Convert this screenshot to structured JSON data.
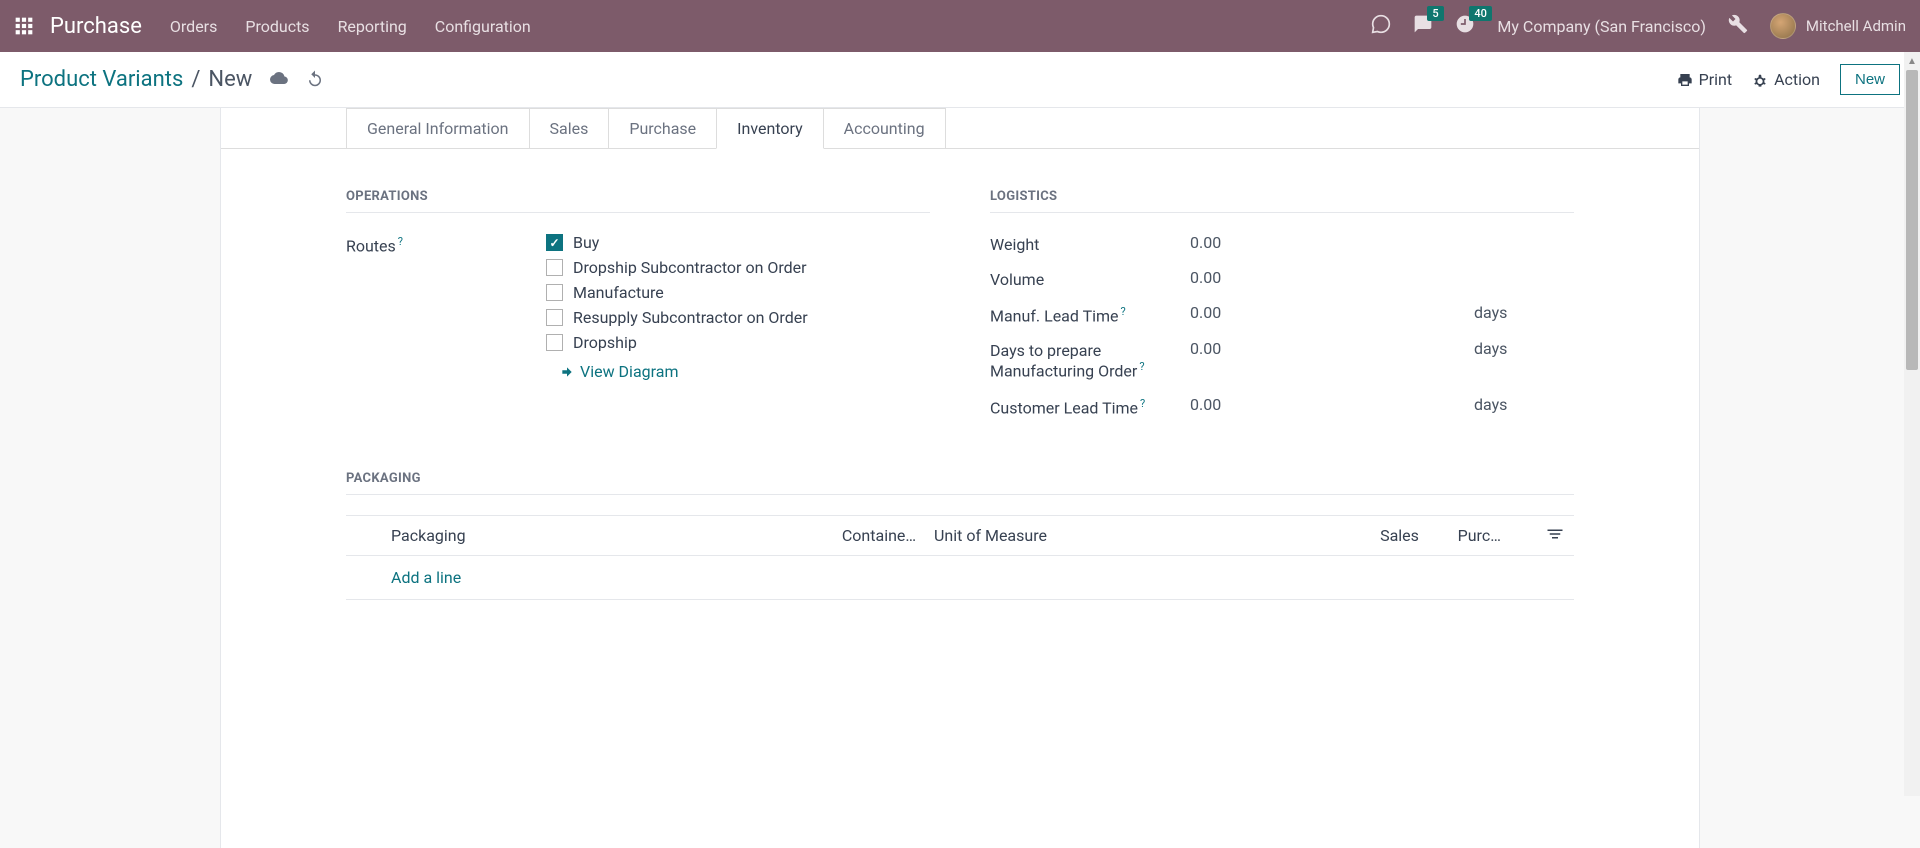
{
  "topbar": {
    "brand": "Purchase",
    "menu": [
      "Orders",
      "Products",
      "Reporting",
      "Configuration"
    ],
    "messages_badge": "5",
    "activities_badge": "40",
    "company": "My Company (San Francisco)",
    "user": "Mitchell Admin"
  },
  "subhead": {
    "bc_root": "Product Variants",
    "bc_sep": "/",
    "bc_current": "New",
    "print": "Print",
    "action": "Action",
    "new_btn": "New"
  },
  "tabs": [
    "General Information",
    "Sales",
    "Purchase",
    "Inventory",
    "Accounting"
  ],
  "active_tab": "Inventory",
  "operations": {
    "title": "OPERATIONS",
    "routes_label": "Routes",
    "routes": [
      {
        "label": "Buy",
        "checked": true
      },
      {
        "label": "Dropship Subcontractor on Order",
        "checked": false
      },
      {
        "label": "Manufacture",
        "checked": false
      },
      {
        "label": "Resupply Subcontractor on Order",
        "checked": false
      },
      {
        "label": "Dropship",
        "checked": false
      }
    ],
    "view_diagram": "View Diagram"
  },
  "logistics": {
    "title": "LOGISTICS",
    "rows": [
      {
        "label": "Weight",
        "value": "0.00",
        "unit": "",
        "help": false
      },
      {
        "label": "Volume",
        "value": "0.00",
        "unit": "",
        "help": false
      },
      {
        "label": "Manuf. Lead Time",
        "value": "0.00",
        "unit": "days",
        "help": true
      },
      {
        "label": "Days to prepare Manufacturing Order",
        "value": "0.00",
        "unit": "days",
        "help": true
      },
      {
        "label": "Customer Lead Time",
        "value": "0.00",
        "unit": "days",
        "help": true
      }
    ]
  },
  "packaging": {
    "title": "PACKAGING",
    "columns": {
      "pkg": "Packaging",
      "cont": "Containe…",
      "uom": "Unit of Measure",
      "sales": "Sales",
      "purc": "Purc…"
    },
    "add_line": "Add a line"
  },
  "help_char": "?"
}
